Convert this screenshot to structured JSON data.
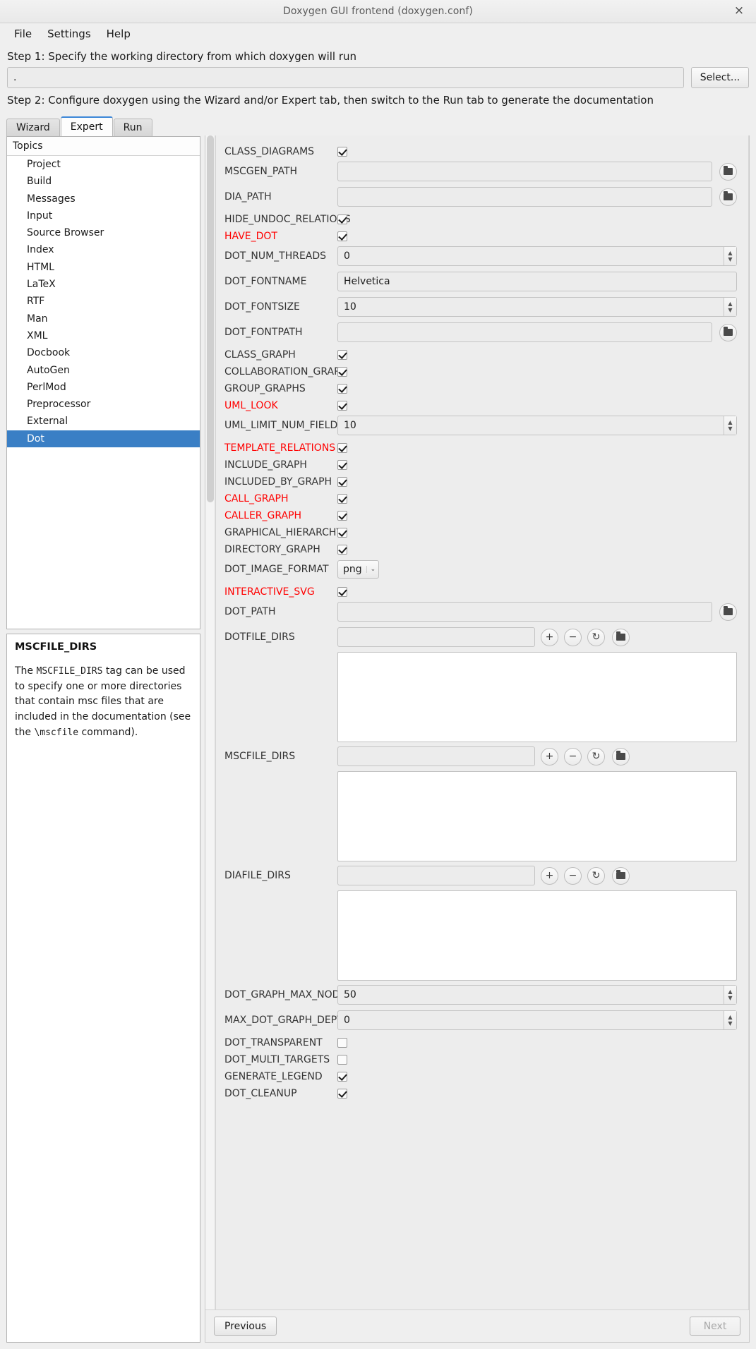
{
  "window": {
    "title": "Doxygen GUI frontend (doxygen.conf)",
    "close_label": "×"
  },
  "menubar": {
    "items": [
      {
        "label": "File"
      },
      {
        "label": "Settings"
      },
      {
        "label": "Help"
      }
    ]
  },
  "steps": {
    "step1_label": "Step 1: Specify the working directory from which doxygen will run",
    "workdir_value": ".",
    "workdir_placeholder": "",
    "select_button": "Select...",
    "step2_label": "Step 2: Configure doxygen using the Wizard and/or Expert tab, then switch to the Run tab to generate the documentation"
  },
  "tabs": [
    {
      "label": "Wizard",
      "active": false
    },
    {
      "label": "Expert",
      "active": true
    },
    {
      "label": "Run",
      "active": false
    }
  ],
  "topics": {
    "header": "Topics",
    "items": [
      {
        "label": "Project",
        "selected": false
      },
      {
        "label": "Build",
        "selected": false
      },
      {
        "label": "Messages",
        "selected": false
      },
      {
        "label": "Input",
        "selected": false
      },
      {
        "label": "Source Browser",
        "selected": false
      },
      {
        "label": "Index",
        "selected": false
      },
      {
        "label": "HTML",
        "selected": false
      },
      {
        "label": "LaTeX",
        "selected": false
      },
      {
        "label": "RTF",
        "selected": false
      },
      {
        "label": "Man",
        "selected": false
      },
      {
        "label": "XML",
        "selected": false
      },
      {
        "label": "Docbook",
        "selected": false
      },
      {
        "label": "AutoGen",
        "selected": false
      },
      {
        "label": "PerlMod",
        "selected": false
      },
      {
        "label": "Preprocessor",
        "selected": false
      },
      {
        "label": "External",
        "selected": false
      },
      {
        "label": "Dot",
        "selected": true
      }
    ]
  },
  "help": {
    "title": "MSCFILE_DIRS",
    "line1_a": "The ",
    "line1_tag": "MSCFILE_DIRS",
    "line1_b": " tag can be used to specify",
    "line2": "one or more directories that contain msc files",
    "line3": "that are included in the documentation (see the",
    "line4_cmd": "\\mscfile",
    "line4_b": " command)."
  },
  "settings": {
    "class_diagrams": {
      "label": "CLASS_DIAGRAMS",
      "checked": true,
      "required": false
    },
    "mscgen_path": {
      "label": "MSCGEN_PATH",
      "value": ""
    },
    "dia_path": {
      "label": "DIA_PATH",
      "value": ""
    },
    "hide_undoc_relations": {
      "label": "HIDE_UNDOC_RELATIONS",
      "checked": true,
      "required": false
    },
    "have_dot": {
      "label": "HAVE_DOT",
      "checked": true,
      "required": true
    },
    "dot_num_threads": {
      "label": "DOT_NUM_THREADS",
      "value": "0"
    },
    "dot_fontname": {
      "label": "DOT_FONTNAME",
      "value": "Helvetica"
    },
    "dot_fontsize": {
      "label": "DOT_FONTSIZE",
      "value": "10"
    },
    "dot_fontpath": {
      "label": "DOT_FONTPATH",
      "value": ""
    },
    "class_graph": {
      "label": "CLASS_GRAPH",
      "checked": true,
      "required": false
    },
    "collaboration_graph": {
      "label": "COLLABORATION_GRAPH",
      "checked": true,
      "required": false
    },
    "group_graphs": {
      "label": "GROUP_GRAPHS",
      "checked": true,
      "required": false
    },
    "uml_look": {
      "label": "UML_LOOK",
      "checked": true,
      "required": true
    },
    "uml_limit_num_fields": {
      "label": "UML_LIMIT_NUM_FIELDS",
      "value": "10"
    },
    "template_relations": {
      "label": "TEMPLATE_RELATIONS",
      "checked": true,
      "required": true
    },
    "include_graph": {
      "label": "INCLUDE_GRAPH",
      "checked": true,
      "required": false
    },
    "included_by_graph": {
      "label": "INCLUDED_BY_GRAPH",
      "checked": true,
      "required": false
    },
    "call_graph": {
      "label": "CALL_GRAPH",
      "checked": true,
      "required": true
    },
    "caller_graph": {
      "label": "CALLER_GRAPH",
      "checked": true,
      "required": true
    },
    "graphical_hierarchy": {
      "label": "GRAPHICAL_HIERARCHY",
      "checked": true,
      "required": false
    },
    "directory_graph": {
      "label": "DIRECTORY_GRAPH",
      "checked": true,
      "required": false
    },
    "dot_image_format": {
      "label": "DOT_IMAGE_FORMAT",
      "value": "png",
      "caret": "⌄"
    },
    "interactive_svg": {
      "label": "INTERACTIVE_SVG",
      "checked": true,
      "required": true
    },
    "dot_path": {
      "label": "DOT_PATH",
      "value": ""
    },
    "dotfile_dirs": {
      "label": "DOTFILE_DIRS",
      "value": ""
    },
    "mscfile_dirs": {
      "label": "MSCFILE_DIRS",
      "value": ""
    },
    "diafile_dirs": {
      "label": "DIAFILE_DIRS",
      "value": ""
    },
    "dot_graph_max_nodes": {
      "label": "DOT_GRAPH_MAX_NODES",
      "value": "50"
    },
    "max_dot_graph_depth": {
      "label": "MAX_DOT_GRAPH_DEPTH",
      "value": "0"
    },
    "dot_transparent": {
      "label": "DOT_TRANSPARENT",
      "checked": false,
      "required": false
    },
    "dot_multi_targets": {
      "label": "DOT_MULTI_TARGETS",
      "checked": false,
      "required": false
    },
    "generate_legend": {
      "label": "GENERATE_LEGEND",
      "checked": true,
      "required": false
    },
    "dot_cleanup": {
      "label": "DOT_CLEANUP",
      "checked": true,
      "required": false
    }
  },
  "list_buttons": {
    "add": "+",
    "remove": "−",
    "update": "↻",
    "browse": "folder-icon"
  },
  "footer": {
    "previous": "Previous",
    "next": "Next"
  },
  "colors": {
    "required_label": "#ff0000",
    "selection": "#3a7fc5",
    "tab_accent": "#3d87d8"
  }
}
